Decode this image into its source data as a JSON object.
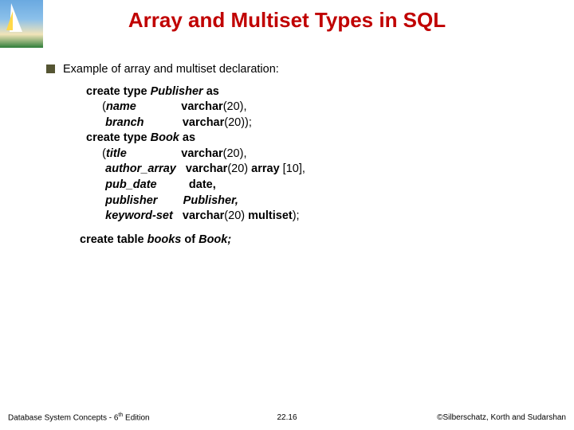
{
  "title": "Array and Multiset Types in SQL",
  "bullet_text": "Example of array and multiset declaration:",
  "code": {
    "l1_a": "create type ",
    "l1_b": "Publisher",
    "l1_c": " as",
    "l2_a": "     (",
    "l2_b": "name",
    "l2_c": "              varchar",
    "l2_d": "(20),",
    "l3_a": "      ",
    "l3_b": "branch",
    "l3_c": "            varchar",
    "l3_d": "(20));",
    "l4_a": "create type ",
    "l4_b": "Book",
    "l4_c": " as",
    "l5_a": "     (",
    "l5_b": "title",
    "l5_c": "                 varchar",
    "l5_d": "(20),",
    "l6_a": "      ",
    "l6_b": "author_array",
    "l6_c": "   varchar",
    "l6_d": "(20) ",
    "l6_e": "array",
    "l6_f": " [10],",
    "l7_a": "      ",
    "l7_b": "pub_date",
    "l7_c": "          date,",
    "l8_a": "      ",
    "l8_b": "publisher",
    "l8_c": "        Publisher,",
    "l9_a": "      ",
    "l9_b": "keyword-set",
    "l9_c": "   varchar",
    "l9_d": "(20) ",
    "l9_e": "multiset",
    "l9_f": ");"
  },
  "ct": {
    "a": "create table ",
    "b": "books",
    "c": " of ",
    "d": "Book",
    "e": ";"
  },
  "footer": {
    "left_a": "Database System Concepts - 6",
    "left_b": " Edition",
    "center": "22.16",
    "right": "©Silberschatz, Korth and Sudarshan"
  }
}
